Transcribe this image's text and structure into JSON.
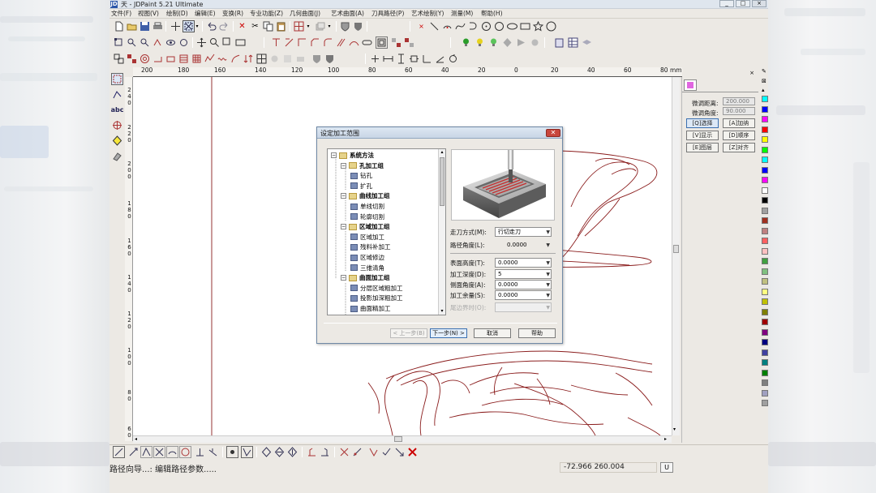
{
  "app": {
    "title": "天 - JDPaint 5.21 Ultimate",
    "window_buttons": [
      "_",
      "□",
      "×"
    ]
  },
  "menu": [
    "文件(F)",
    "视图(V)",
    "绘制(D)",
    "编辑(E)",
    "变换(R)",
    "专业功能(Z)",
    "几何曲面(J)",
    "艺术曲面(A)",
    "刀具路径(P)",
    "艺术绘制(Y)",
    "测量(M)",
    "帮助(H)"
  ],
  "rulers": {
    "h_labels": [
      "200",
      "180",
      "160",
      "140",
      "120",
      "100",
      "80",
      "60",
      "40",
      "20",
      "0",
      "20",
      "40",
      "60",
      "80"
    ],
    "unit": "mm",
    "v_labels": [
      [
        "2",
        "4",
        "0"
      ],
      [
        "2",
        "2",
        "0"
      ],
      [
        "2",
        "0",
        "0"
      ],
      [
        "1",
        "8",
        "0"
      ],
      [
        "1",
        "6",
        "0"
      ],
      [
        "1",
        "4",
        "0"
      ],
      [
        "1",
        "2",
        "0"
      ],
      [
        "1",
        "0",
        "0"
      ],
      [
        "8",
        "0"
      ],
      [
        "6",
        "0"
      ]
    ]
  },
  "right_panel": {
    "fine_distance_label": "微调距离:",
    "fine_distance_value": "200.000",
    "fine_angle_label": "微调角度:",
    "fine_angle_value": "90.000",
    "buttons": [
      "[Q]选择",
      "[A]加纳",
      "[V]显示",
      "[D]顺序",
      "[E]图层",
      "[Z]对齐"
    ]
  },
  "colors": [
    "#00ffff",
    "#0000ff",
    "#ff00ff",
    "#ff0000",
    "#ffff00",
    "#00ff00",
    "#00ffff",
    "#0000ff",
    "#ff00ff",
    "#ffffff",
    "#000000",
    "#a0a0a0",
    "#a03020",
    "#c08080",
    "#ff6060",
    "#ffc0c0",
    "#40a040",
    "#80c080",
    "#c0c080",
    "#ffff80",
    "#c0c000",
    "#808000",
    "#a00000",
    "#800080",
    "#000080",
    "#4040a0",
    "#008080",
    "#008000",
    "#808080",
    "#a0a0c0",
    "#a0a0a0"
  ],
  "dialog": {
    "title": "设定加工范围",
    "tree": [
      {
        "level": 0,
        "type": "folder",
        "label": "系统方法",
        "bold": true
      },
      {
        "level": 1,
        "type": "folder",
        "label": "孔加工组",
        "bold": true
      },
      {
        "level": 2,
        "type": "leaf",
        "label": "钻孔"
      },
      {
        "level": 2,
        "type": "leaf",
        "label": "扩孔"
      },
      {
        "level": 1,
        "type": "folder",
        "label": "曲线加工组",
        "bold": true
      },
      {
        "level": 2,
        "type": "leaf",
        "label": "单线切割"
      },
      {
        "level": 2,
        "type": "leaf",
        "label": "轮廓切割"
      },
      {
        "level": 1,
        "type": "folder",
        "label": "区域加工组",
        "bold": true
      },
      {
        "level": 2,
        "type": "leaf",
        "label": "区域加工"
      },
      {
        "level": 2,
        "type": "leaf",
        "label": "残料补加工"
      },
      {
        "level": 2,
        "type": "leaf",
        "label": "区域修边"
      },
      {
        "level": 2,
        "type": "leaf",
        "label": "三维清角"
      },
      {
        "level": 1,
        "type": "folder",
        "label": "曲面加工组",
        "bold": true
      },
      {
        "level": 2,
        "type": "leaf",
        "label": "分层区域粗加工"
      },
      {
        "level": 2,
        "type": "leaf",
        "label": "投影加深粗加工"
      },
      {
        "level": 2,
        "type": "leaf",
        "label": "曲面精加工"
      }
    ],
    "fields": {
      "tool_mode": {
        "label": "走刀方式(M):",
        "value": "行切走刀"
      },
      "path_angle": {
        "label": "路径角度(L):",
        "value": "0.0000"
      },
      "surface_height": {
        "label": "表面高度(T):",
        "value": "0.0000"
      },
      "depth": {
        "label": "加工深度(D):",
        "value": "5"
      },
      "side_angle": {
        "label": "侧面角度(A):",
        "value": "0.0000"
      },
      "allowance": {
        "label": "加工余量(S):",
        "value": "0.0000"
      },
      "boundary": {
        "label": "尾边界时(O):",
        "value": ""
      }
    },
    "buttons": {
      "prev": "< 上一步(B)",
      "next": "下一步(N) >",
      "cancel": "取消",
      "help": "帮助"
    }
  },
  "status": {
    "message": "路径向导...: 编辑路径参数.....",
    "coords": "-72.966 260.004",
    "unit": "U"
  }
}
